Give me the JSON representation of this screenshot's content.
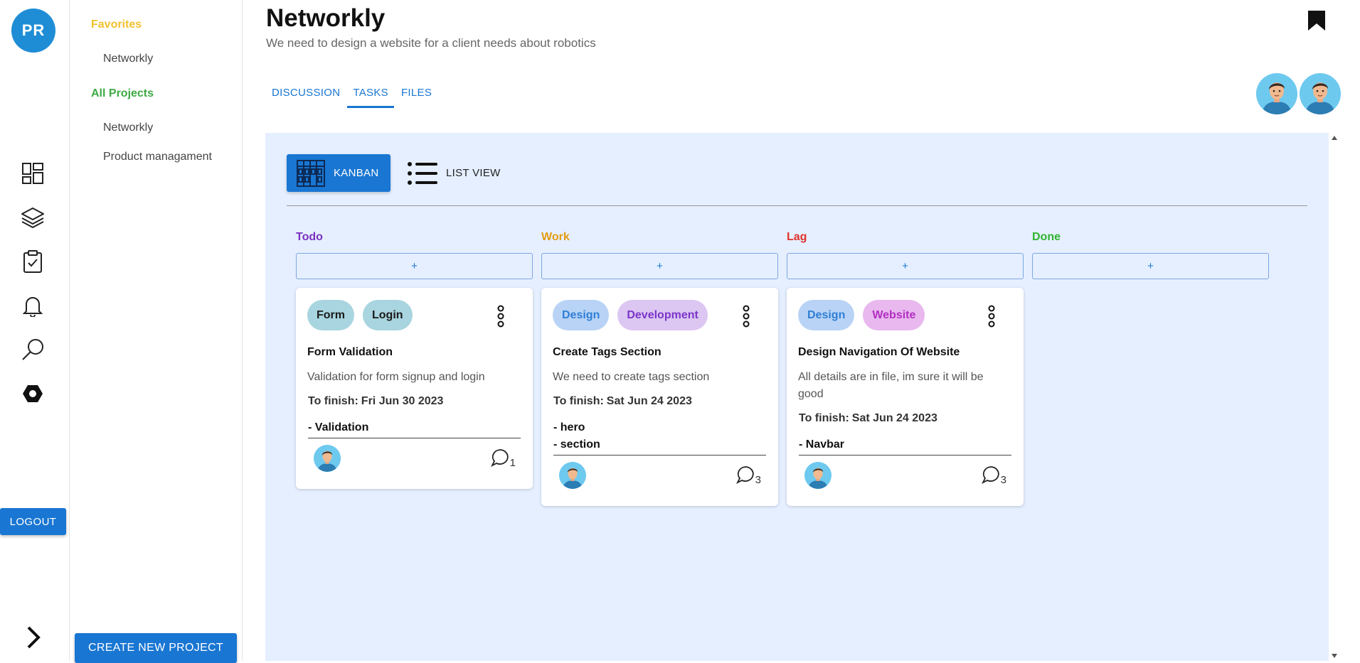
{
  "user": {
    "initials": "PR"
  },
  "rail": {
    "icons": [
      "dashboard-icon",
      "layers-icon",
      "task-clipboard-icon",
      "bell-icon",
      "search-icon",
      "settings-hexagon-icon"
    ],
    "logout_label": "LOGOUT",
    "expand_icon": "chevron-right-icon"
  },
  "sidebar": {
    "favorites_label": "Favorites",
    "favorites": [
      "Networkly"
    ],
    "all_projects_label": "All Projects",
    "projects": [
      "Networkly",
      "Product managament"
    ],
    "create_label": "CREATE NEW PROJECT",
    "colors": {
      "favorites": "#f2c12e",
      "all_projects": "#3ea943"
    }
  },
  "project": {
    "title": "Networkly",
    "subtitle": "We need to design a website for a client needs about robotics"
  },
  "tabs": [
    {
      "label": "DISCUSSION",
      "active": false
    },
    {
      "label": "TASKS",
      "active": true
    },
    {
      "label": "FILES",
      "active": false
    }
  ],
  "views": {
    "kanban_label": "KANBAN",
    "list_label": "LIST VIEW",
    "active": "kanban"
  },
  "columns": [
    {
      "title": "Todo",
      "color": "#7b2fc0",
      "add_label": "+"
    },
    {
      "title": "Work",
      "color": "#e49b13",
      "add_label": "+"
    },
    {
      "title": "Lag",
      "color": "#e0332a",
      "add_label": "+"
    },
    {
      "title": "Done",
      "color": "#2fb52f",
      "add_label": "+"
    }
  ],
  "cards": [
    {
      "column": "Todo",
      "tags": [
        {
          "label": "Form",
          "bg": "#a8d5df",
          "fg": "#1a1a1a"
        },
        {
          "label": "Login",
          "bg": "#a8d5df",
          "fg": "#1a1a1a"
        }
      ],
      "title": "Form Validation",
      "description": "Validation for form signup and login",
      "finish_label": "To finish:",
      "finish_date": "Fri Jun 30 2023",
      "subtasks": [
        "- Validation"
      ],
      "comments": "1"
    },
    {
      "column": "Work",
      "tags": [
        {
          "label": "Design",
          "bg": "#b8d3f5",
          "fg": "#2f7fd6"
        },
        {
          "label": "Development",
          "bg": "#dcc6f2",
          "fg": "#7b35c9"
        }
      ],
      "title": "Create Tags Section",
      "description": "We need to create tags section",
      "finish_label": "To finish:",
      "finish_date": "Sat Jun 24 2023",
      "subtasks": [
        "- hero",
        "- section"
      ],
      "comments": "3"
    },
    {
      "column": "Lag",
      "tags": [
        {
          "label": "Design",
          "bg": "#b8d3f5",
          "fg": "#2f7fd6"
        },
        {
          "label": "Website",
          "bg": "#e8b8ee",
          "fg": "#b22ec2"
        }
      ],
      "title": "Design Navigation Of Website",
      "description": "All details are in file, im sure it will be good",
      "finish_label": "To finish:",
      "finish_date": "Sat Jun 24 2023",
      "subtasks": [
        "- Navbar"
      ],
      "comments": "3"
    }
  ]
}
